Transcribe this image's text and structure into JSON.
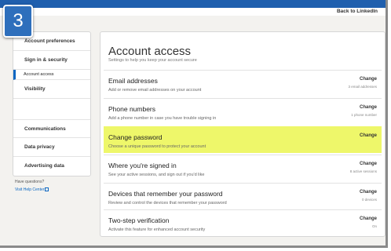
{
  "step_number": "3",
  "header": {
    "back_link": "Back to LinkedIn"
  },
  "sidebar": {
    "items": [
      {
        "label": "Account preferences"
      },
      {
        "label": "Sign in & security"
      },
      {
        "label": "Account access"
      },
      {
        "label": "Visibility"
      },
      {
        "label": "Communications"
      },
      {
        "label": "Data privacy"
      },
      {
        "label": "Advertising data"
      }
    ],
    "help_question": "Have questions?",
    "help_link": "Visit Help Center"
  },
  "main": {
    "title": "Account access",
    "subtitle": "Settings to help you keep your account secure",
    "rows": [
      {
        "title": "Email addresses",
        "desc": "Add or remove email addresses on your account",
        "action": "Change",
        "meta": "3 email addresses"
      },
      {
        "title": "Phone numbers",
        "desc": "Add a phone number in case you have trouble signing in",
        "action": "Change",
        "meta": "1 phone number"
      },
      {
        "title": "Change password",
        "desc": "Choose a unique password to protect your account",
        "action": "Change",
        "meta": ""
      },
      {
        "title": "Where you're signed in",
        "desc": "See your active sessions, and sign out if you'd like",
        "action": "Change",
        "meta": "8 active sessions"
      },
      {
        "title": "Devices that remember your password",
        "desc": "Review and control the devices that remember your password",
        "action": "Change",
        "meta": "0 devices"
      },
      {
        "title": "Two-step verification",
        "desc": "Activate this feature for enhanced account security",
        "action": "Change",
        "meta": "On"
      }
    ]
  },
  "colors": {
    "accent": "#0a66c2",
    "highlight": "#eef76a",
    "badge": "#2e6fbc"
  },
  "icons": {
    "help_link": "external-link-icon"
  }
}
